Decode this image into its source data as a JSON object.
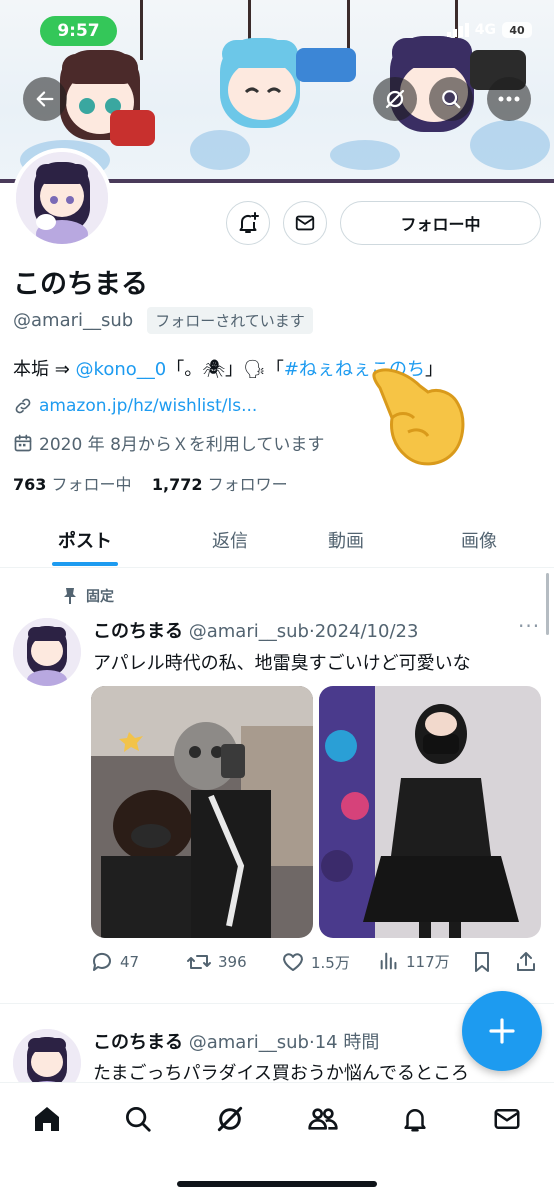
{
  "status_bar": {
    "time": "9:57",
    "network": "4G",
    "battery": "40"
  },
  "profile": {
    "name": "このちまる",
    "handle": "@amari__sub",
    "follows_you": "フォローされています",
    "follow_button": "フォロー中",
    "bio_prefix": "本垢 ⇒ ",
    "bio_mention": "@kono__0",
    "bio_middle": "「。🕷」🗣「",
    "bio_hashtag": "#ねぇねぇこのち",
    "bio_suffix": "」",
    "website": "amazon.jp/hz/wishlist/ls...",
    "joined": "2020 年 8月からＸを利用しています",
    "following_count": "763",
    "following_label": "フォロー中",
    "followers_count": "1,772",
    "followers_label": "フォロワー"
  },
  "tabs": [
    {
      "label": "ポスト",
      "active": true
    },
    {
      "label": "返信"
    },
    {
      "label": "動画"
    },
    {
      "label": "画像"
    }
  ],
  "posts": [
    {
      "pinned_label": "固定",
      "name": "このちまる",
      "handle": "@amari__sub",
      "separator": "·",
      "time": "2024/10/23",
      "text": "アパレル時代の私、地雷臭すごいけど可愛いな",
      "replies": "47",
      "reposts": "396",
      "likes": "1.5万",
      "views": "117万"
    },
    {
      "name": "このちまる",
      "handle": "@amari__sub",
      "separator": "·",
      "time": "14 時間",
      "text": "たまごっちパラダイス買おうか悩んでるところ"
    }
  ],
  "colors": {
    "accent": "#1d9bf0",
    "status_pill": "#34c759",
    "text": "#0f1419",
    "muted": "#536471"
  },
  "icons": {
    "back": "arrow-left-icon",
    "grok": "grok-icon",
    "search": "search-icon",
    "more": "more-icon",
    "notify": "bell-plus-icon",
    "message": "mail-icon",
    "link": "link-icon",
    "calendar": "calendar-icon",
    "pin": "pin-icon",
    "reply": "reply-icon",
    "repost": "repost-icon",
    "like": "heart-icon",
    "views": "views-icon",
    "bookmark": "bookmark-icon",
    "share": "share-icon",
    "compose": "plus-icon",
    "nav_home": "home-icon",
    "nav_search": "search-icon",
    "nav_grok": "grok-icon",
    "nav_communities": "communities-icon",
    "nav_notifications": "bell-icon",
    "nav_messages": "mail-icon"
  }
}
